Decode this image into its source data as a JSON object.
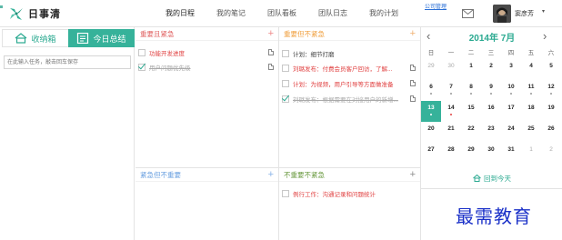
{
  "app": {
    "logo_text": "日事清",
    "logo_icon": "logo-leaf-icon"
  },
  "nav": [
    "我的日程",
    "我的笔记",
    "团队看板",
    "团队日志",
    "我的计划"
  ],
  "top_link": "公司管理",
  "user": {
    "name": "窦彦芳",
    "caret": "▾"
  },
  "left": {
    "tabs": [
      {
        "label": "收纳箱",
        "icon": "inbox-icon"
      },
      {
        "label": "今日总结",
        "icon": "summary-icon"
      }
    ],
    "task_input_placeholder": "在此输入任务，敲击回车保存"
  },
  "quadrants": {
    "q1": {
      "title": "重要且紧急",
      "tasks": [
        {
          "text": "功能开发进度",
          "checked": false,
          "style": "red",
          "has_note": true
        },
        {
          "text": "用户问题优先级",
          "checked": true,
          "style": "done",
          "has_note": true
        }
      ]
    },
    "q2": {
      "title": "重要但不紧急",
      "tasks": [
        {
          "text": "计划：细节打磨",
          "checked": false,
          "style": "dark",
          "has_note": false
        },
        {
          "text": "刘璐发布：付费会员客户回访，了解...",
          "checked": false,
          "style": "red",
          "has_note": true
        },
        {
          "text": "计划：为视频，用户引导等方面做准备",
          "checked": false,
          "style": "red",
          "has_note": true
        },
        {
          "text": "刘璐发布：根据需要在对接用户的新增...",
          "checked": true,
          "style": "done",
          "has_note": true
        }
      ]
    },
    "q3": {
      "title": "紧急但不重要",
      "tasks": []
    },
    "q4": {
      "title": "不重要不紧急",
      "tasks": [
        {
          "text": "例行工作：沟通记录和问题统计",
          "checked": false,
          "style": "red",
          "has_note": false
        }
      ]
    }
  },
  "calendar": {
    "title": "2014年 7月",
    "prev": "‹",
    "next": "›",
    "weekdays": [
      "日",
      "一",
      "二",
      "三",
      "四",
      "五",
      "六"
    ],
    "weeks": [
      [
        {
          "d": "29",
          "dim": true
        },
        {
          "d": "30",
          "dim": true
        },
        {
          "d": "1"
        },
        {
          "d": "2"
        },
        {
          "d": "3"
        },
        {
          "d": "4"
        },
        {
          "d": "5"
        }
      ],
      [
        {
          "d": "6",
          "dot": "grey"
        },
        {
          "d": "7",
          "dot": "grey"
        },
        {
          "d": "8",
          "dot": "grey"
        },
        {
          "d": "9",
          "dot": "grey"
        },
        {
          "d": "10",
          "dot": "grey"
        },
        {
          "d": "11",
          "dot": "grey"
        },
        {
          "d": "12",
          "dot": "grey"
        }
      ],
      [
        {
          "d": "13",
          "today": true,
          "dot": "white"
        },
        {
          "d": "14",
          "dot": "red"
        },
        {
          "d": "15"
        },
        {
          "d": "16"
        },
        {
          "d": "17"
        },
        {
          "d": "18"
        },
        {
          "d": "19"
        }
      ],
      [
        {
          "d": "20"
        },
        {
          "d": "21"
        },
        {
          "d": "22"
        },
        {
          "d": "23"
        },
        {
          "d": "24"
        },
        {
          "d": "25"
        },
        {
          "d": "26"
        }
      ],
      [
        {
          "d": "27"
        },
        {
          "d": "28"
        },
        {
          "d": "29"
        },
        {
          "d": "30"
        },
        {
          "d": "31"
        },
        {
          "d": "1",
          "dim": true
        },
        {
          "d": "2",
          "dim": true
        }
      ]
    ],
    "back_today": "回到今天"
  },
  "watermark": "最需教育",
  "colors": {
    "accent": "#36b29a",
    "q1": "#e06060",
    "q2": "#f0a040",
    "q3": "#6aa0e0",
    "q4": "#6a9a40",
    "red_text": "#e04040",
    "watermark": "#1a30c8"
  }
}
